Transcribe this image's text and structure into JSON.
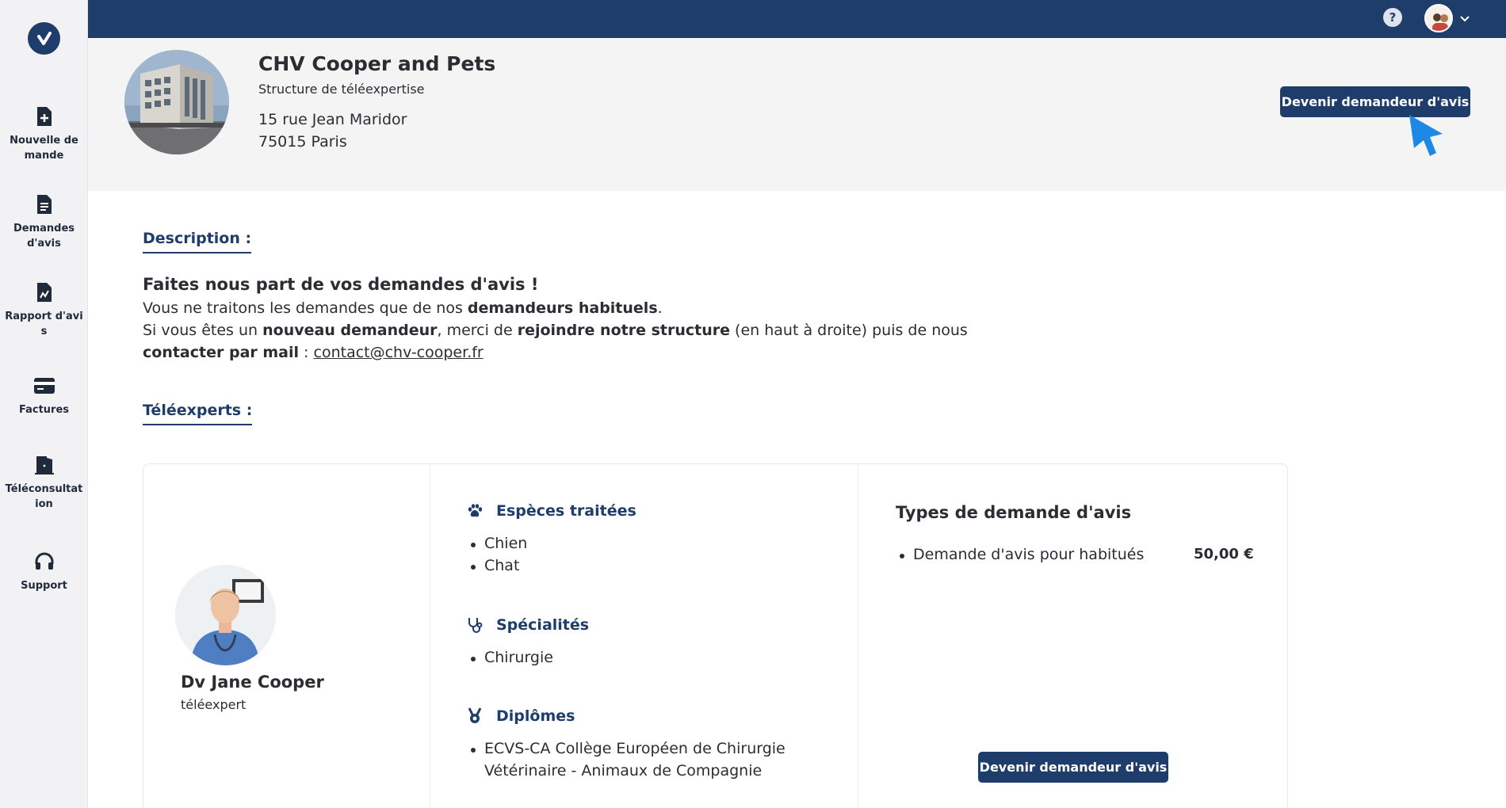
{
  "sidebar": {
    "items": [
      {
        "label": "Nouvelle demande",
        "icon": "file-plus-icon"
      },
      {
        "label": "Demandes d'avis",
        "icon": "file-text-icon"
      },
      {
        "label": "Rapport d'avis",
        "icon": "file-chart-icon"
      },
      {
        "label": "Factures",
        "icon": "credit-card-icon"
      },
      {
        "label": "Téléconsultation",
        "icon": "door-exit-icon"
      },
      {
        "label": "Support",
        "icon": "headset-icon"
      }
    ]
  },
  "topbar": {
    "help_label": "?"
  },
  "header": {
    "name": "CHV Cooper and Pets",
    "type": "Structure de téléexpertise",
    "address_line1": "15 rue Jean Maridor",
    "address_line2": "75015 Paris",
    "cta_label": "Devenir demandeur d'avis"
  },
  "description": {
    "title": "Description :",
    "headline": "Faites nous part de vos demandes d'avis !",
    "line1_a": "Vous ne traitons les demandes que de nos ",
    "line1_b": "demandeurs habituels",
    "line1_c": ".",
    "line2_a": "Si vous êtes un ",
    "line2_b": "nouveau demandeur",
    "line2_c": ", merci de ",
    "line2_d": "rejoindre notre structure",
    "line2_e": " (en haut à droite) puis de nous",
    "line3_a": "contacter par mail",
    "line3_b": " : ",
    "email": "contact@chv-cooper.fr"
  },
  "teleexperts": {
    "title": "Téléexperts :",
    "expert": {
      "name": "Dv Jane Cooper",
      "role": "téléexpert",
      "species_title": "Espèces traitées",
      "species": [
        "Chien",
        "Chat"
      ],
      "specialties_title": "Spécialités",
      "specialties": [
        "Chirurgie"
      ],
      "diplomas_title": "Diplômes",
      "diplomas": [
        "ECVS-CA Collège Européen de Chirurgie",
        "Vétérinaire - Animaux de Compagnie"
      ],
      "types_title": "Types de demande d'avis",
      "types": [
        {
          "label": "Demande d'avis pour habitués",
          "price": "50,00 €"
        }
      ],
      "cta_label": "Devenir demandeur d'avis"
    }
  },
  "colors": {
    "primary": "#1f3d6b",
    "cursor": "#1e88e5"
  }
}
